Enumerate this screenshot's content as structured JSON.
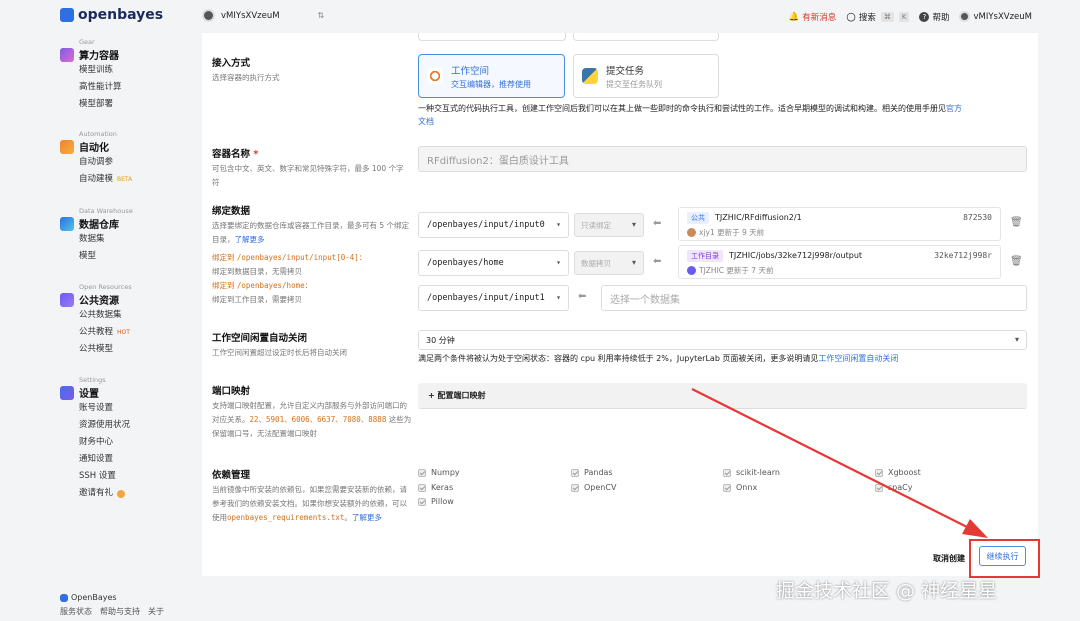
{
  "brand": {
    "name": "openbayes",
    "footer_name": "OpenBayes",
    "accent": "#2f6fdf"
  },
  "topbar": {
    "account": "vMIYsXVzeuM",
    "news": "有新消息",
    "search": "搜索",
    "kbd1": "⌘",
    "kbd2": "K",
    "help": "帮助",
    "user": "vMIYsXVzeuM"
  },
  "sidebar": {
    "groups": [
      {
        "category": "Gear",
        "title": "算力容器",
        "items": [
          "模型训练",
          "高性能计算",
          "模型部署"
        ]
      },
      {
        "category": "Automation",
        "title": "自动化",
        "items": [
          "自动调参",
          "自动建模"
        ],
        "badge": "BETA"
      },
      {
        "category": "Data Warehouse",
        "title": "数据仓库",
        "items": [
          "数据集",
          "模型"
        ]
      },
      {
        "category": "Open Resources",
        "title": "公共资源",
        "items": [
          "公共数据集",
          "公共教程",
          "公共模型"
        ],
        "badge": "HOT"
      },
      {
        "category": "Settings",
        "title": "设置",
        "items": [
          "账号设置",
          "资源使用状况",
          "财务中心",
          "通知设置",
          "SSH 设置",
          "邀请有礼"
        ]
      }
    ],
    "footer_links": [
      "服务状态",
      "帮助与支持",
      "关于"
    ]
  },
  "form": {
    "access": {
      "label": "接入方式",
      "desc": "选择容器的执行方式",
      "options": [
        {
          "title": "工作空间",
          "sub": "交互编辑器，推荐使用"
        },
        {
          "title": "提交任务",
          "sub": "提交至任务队列"
        }
      ],
      "explain": "一种交互式的代码执行工具，创建工作空间后我们可以在其上做一些即时的命令执行和尝试性的工作。适合早期模型的调试和构建。相关的使用手册见",
      "explain_link_1": "官方",
      "explain_link_2": "文档"
    },
    "name": {
      "label": "容器名称",
      "required": "*",
      "desc": "可包含中文、英文、数字和常见特殊字符，最多 100 个字符",
      "value": "RFdiffusion2：蛋白质设计工具"
    },
    "bind": {
      "label": "绑定数据",
      "desc": "选择要绑定的数据仓库或容器工作目录，最多可有 5 个绑定目录，",
      "learn_more": "了解更多",
      "hint1_prefix": "绑定到 ",
      "hint1_path": "/openbayes/input/input[0-4]",
      "hint1_suffix": "：",
      "hint1_sub": "绑定到数据目录，无需拷贝",
      "hint2_prefix": "绑定到 ",
      "hint2_path": "/openbayes/home",
      "hint2_suffix": "：",
      "hint2_sub": "绑定到工作目录，需要拷贝",
      "rows": [
        {
          "path": "/openbayes/input/input0",
          "mode": "只读绑定",
          "tag": "公共",
          "source": "TJZHIC/RFdiffusion2/1",
          "id": "872530",
          "meta": "xjy1 更新于 9 天前"
        },
        {
          "path": "/openbayes/home",
          "mode": "数据拷贝",
          "tag": "工作目录",
          "source": "TJZHIC/jobs/32ke712j998r/output",
          "id": "32ke712j998r",
          "meta": "TJZHIC 更新于 7 天前"
        },
        {
          "path": "/openbayes/input/input1",
          "placeholder": "选择一个数据集"
        }
      ]
    },
    "idle": {
      "label": "工作空间闲置自动关闭",
      "desc": "工作空间闲置超过设定时长后将自动关闭",
      "value": "30 分钟",
      "explain": "满足两个条件将被认为处于空闲状态：容器的 cpu 利用率持续低于 2%，JupyterLab 页面被关闭，更多说明请见",
      "explain_link": "工作空间闲置自动关闭"
    },
    "ports": {
      "label": "端口映射",
      "desc_a": "支持端口映射配置，允许自定义内部服务与外部访问端口的对应关系。",
      "desc_ports": "22、5901、6006、6637、7080、8888",
      "desc_b": " 这些为保留端口号，无法配置端口映射",
      "button": "+ 配置端口映射"
    },
    "deps": {
      "label": "依赖管理",
      "desc": "当前镜像中所安装的依赖包，如果您需要安装新的依赖，请参考我们的依赖安装文档。如果你想安装额外的依赖，可以使用",
      "file": "openbayes_requirements.txt",
      "sep": "。",
      "learn_more": "了解更多",
      "packages": [
        "Numpy",
        "Pandas",
        "scikit-learn",
        "Xgboost",
        "Keras",
        "OpenCV",
        "Onnx",
        "spaCy",
        "Pillow"
      ]
    },
    "actions": {
      "cancel": "取消创建",
      "continue": "继续执行"
    }
  },
  "watermark": "掘金技术社区 @ 神经星星",
  "annotation_color": "#e53935"
}
